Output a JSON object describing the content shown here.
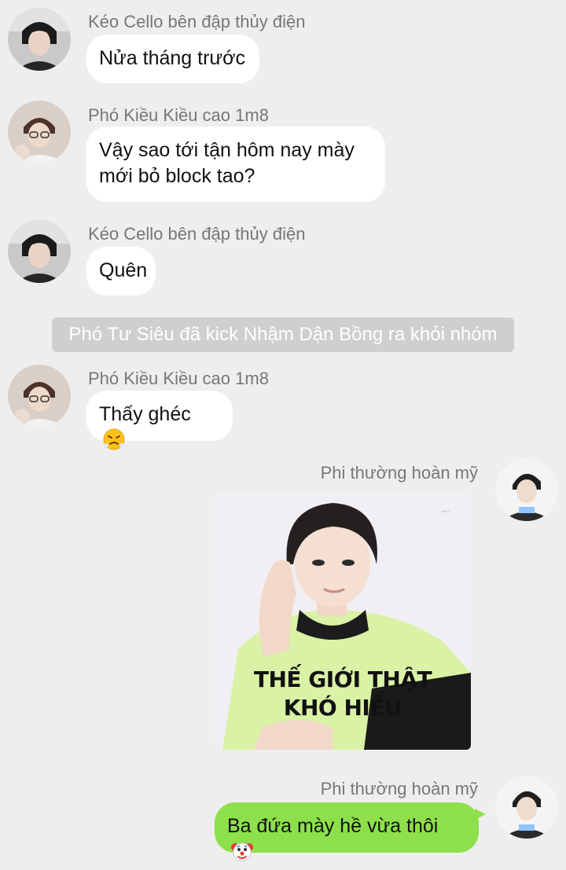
{
  "messages": [
    {
      "sender": "Kéo Cello bên đập thủy điện",
      "text": "Nửa tháng trước"
    },
    {
      "sender": "Phó Kiều Kiều cao 1m8",
      "text_line1": "Vậy sao tới tận hôm nay mày",
      "text_line2": "mới bỏ block tao?"
    },
    {
      "sender": "Kéo Cello bên đập thủy điện",
      "text": "Quên"
    },
    {
      "sender": "Phó Kiều Kiều cao 1m8",
      "text": "Thấy ghéc",
      "emoji": "huffing-face-icon"
    },
    {
      "sender": "Phi thường hoàn mỹ",
      "sticker_line1": "THẾ GIỚI THẬT",
      "sticker_line2": "KHÓ HIỂU"
    },
    {
      "sender": "Phi thường hoàn mỹ",
      "text": "Ba đứa mày hề vừa thôi",
      "emoji": "clown-face-icon"
    }
  ],
  "system_notice": "Phó Tư Siêu đã kick Nhậm Dận Bồng ra khỏi nhóm",
  "colors": {
    "background": "#eeeeee",
    "incoming_bubble": "#ffffff",
    "outgoing_bubble": "#8de04b",
    "sender_name": "#777777",
    "notice_bg": "#cfcfcf"
  }
}
